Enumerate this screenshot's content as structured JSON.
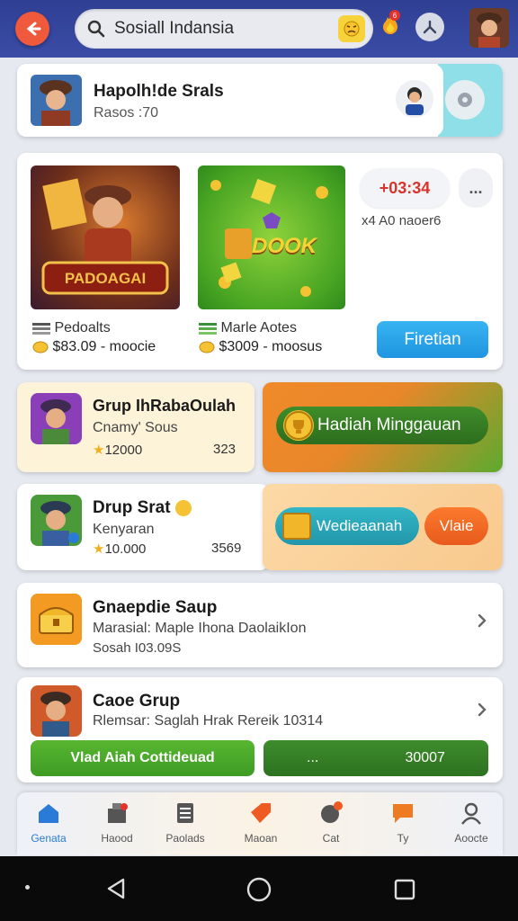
{
  "search": {
    "value": "Sosiall Indansia"
  },
  "header": {
    "notif_count": "6"
  },
  "profile": {
    "title": "Hapolh!de Srals",
    "subtitle": "Rasos :70"
  },
  "featured": {
    "tile1_art_text": "PADOAGAI",
    "tile1_label": "Pedoalts",
    "tile1_coins": "$83.09 - moocie",
    "tile2_art_text": "DOOK",
    "tile2_label": "Marle Aotes",
    "tile2_coins": "$3009 - moosus",
    "timer": "+03:34",
    "more": "...",
    "schedule": "x4 A0 naoer6",
    "action_label": "Firetian"
  },
  "groups": [
    {
      "title": "Grup IhRabaOulah",
      "subtitle": "Cnamy' Sous",
      "points": "12000",
      "count": "323"
    },
    {
      "title": "Drup Srat",
      "subtitle": "Kenyaran",
      "points": "10.000",
      "count": "3569"
    },
    {
      "title": "Gnaepdie Saup",
      "subtitle": "Marasial: Maple Ihona DaolaikIon",
      "meta": "Sosah I03.09S"
    },
    {
      "title": "Caoe Grup",
      "subtitle": "Rlemsar: Saglah Hrak Rereik 10314"
    }
  ],
  "promo": {
    "weekly_label": "Hadiah Minggauan",
    "chest_label": "Wedieaanah",
    "orange_label": "Vlaie",
    "bar1_label": "Vlad Aiah   Cottideuad",
    "bar2_dots": "...",
    "bar2_value": "30007"
  },
  "nav": [
    {
      "label": "Genata",
      "icon": "home-icon"
    },
    {
      "label": "Haood",
      "icon": "shop-icon"
    },
    {
      "label": "Paolads",
      "icon": "list-icon"
    },
    {
      "label": "Maoan",
      "icon": "tag-icon"
    },
    {
      "label": "Cat",
      "icon": "chat-icon"
    },
    {
      "label": "Ty",
      "icon": "message-icon"
    },
    {
      "label": "Aoocte",
      "icon": "profile-icon"
    }
  ],
  "colors": {
    "topbar": "#2f3f93",
    "accent_blue": "#1f95e0",
    "accent_orange": "#e85a1c",
    "accent_green": "#3e9b23"
  }
}
